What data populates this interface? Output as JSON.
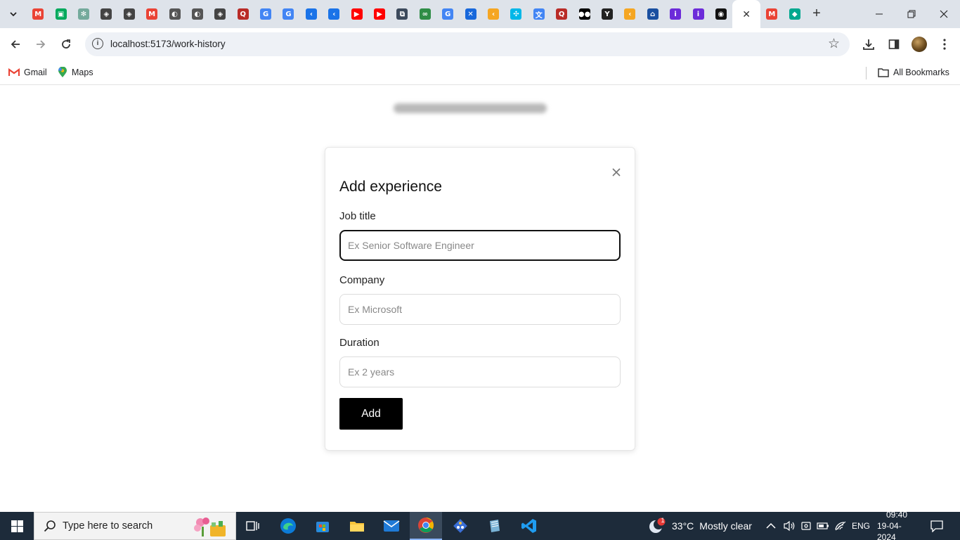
{
  "browser": {
    "tabs": [
      {
        "icon": "gmail-icon",
        "color": "#ea4335",
        "glyph": "M"
      },
      {
        "icon": "google-meet-icon",
        "color": "#00a95c",
        "glyph": "▣"
      },
      {
        "icon": "chatgpt-icon",
        "color": "#74aa9c",
        "glyph": "✻"
      },
      {
        "icon": "shield-icon",
        "color": "#444444",
        "glyph": "◈"
      },
      {
        "icon": "shield-icon",
        "color": "#444444",
        "glyph": "◈"
      },
      {
        "icon": "gmail-icon",
        "color": "#ea4335",
        "glyph": "M"
      },
      {
        "icon": "globe-icon",
        "color": "#555555",
        "glyph": "◐"
      },
      {
        "icon": "globe-icon",
        "color": "#555555",
        "glyph": "◐"
      },
      {
        "icon": "shield-icon",
        "color": "#444444",
        "glyph": "◈"
      },
      {
        "icon": "quora-icon",
        "color": "#b92b27",
        "glyph": "Q"
      },
      {
        "icon": "google-icon",
        "color": "#4285f4",
        "glyph": "G"
      },
      {
        "icon": "google-icon",
        "color": "#4285f4",
        "glyph": "G"
      },
      {
        "icon": "blue-circle-icon",
        "color": "#1a73e8",
        "glyph": "‹"
      },
      {
        "icon": "blue-circle-icon",
        "color": "#1a73e8",
        "glyph": "‹"
      },
      {
        "icon": "youtube-icon",
        "color": "#ff0000",
        "glyph": "▶"
      },
      {
        "icon": "youtube-icon",
        "color": "#ff0000",
        "glyph": "▶"
      },
      {
        "icon": "puzzle-icon",
        "color": "#3c4a5c",
        "glyph": "⧉"
      },
      {
        "icon": "geeksforgeeks-icon",
        "color": "#2f8d46",
        "glyph": "∞"
      },
      {
        "icon": "google-icon",
        "color": "#4285f4",
        "glyph": "G"
      },
      {
        "icon": "confluence-icon",
        "color": "#1868db",
        "glyph": "✕"
      },
      {
        "icon": "code-icon",
        "color": "#f5a623",
        "glyph": "‹"
      },
      {
        "icon": "puzzle-icon",
        "color": "#00b7e8",
        "glyph": "✣"
      },
      {
        "icon": "translate-icon",
        "color": "#4285f4",
        "glyph": "文"
      },
      {
        "icon": "quora-icon",
        "color": "#b92b27",
        "glyph": "Q"
      },
      {
        "icon": "medium-icon",
        "color": "#000000",
        "glyph": "●●"
      },
      {
        "icon": "typeform-icon",
        "color": "#222222",
        "glyph": "Y"
      },
      {
        "icon": "code-icon",
        "color": "#f5a623",
        "glyph": "‹"
      },
      {
        "icon": "bank-icon",
        "color": "#1a4fa0",
        "glyph": "⌂"
      },
      {
        "icon": "purple-badge-icon",
        "color": "#6c2bd9",
        "glyph": "i"
      },
      {
        "icon": "purple-badge-icon",
        "color": "#6c2bd9",
        "glyph": "i"
      },
      {
        "icon": "github-icon",
        "color": "#111111",
        "glyph": "◉"
      }
    ],
    "tabs_after": [
      {
        "icon": "gmail-icon",
        "color": "#ea4335",
        "glyph": "M"
      },
      {
        "icon": "diamond-icon",
        "color": "#00a88f",
        "glyph": "◆"
      }
    ],
    "url": "localhost:5173/work-history",
    "bookmarks": {
      "gmail": "Gmail",
      "maps": "Maps",
      "all": "All Bookmarks"
    }
  },
  "modal": {
    "title": "Add experience",
    "job_title": {
      "label": "Job title",
      "placeholder": "Ex Senior Software Engineer"
    },
    "company": {
      "label": "Company",
      "placeholder": "Ex Microsoft"
    },
    "duration": {
      "label": "Duration",
      "placeholder": "Ex 2 years"
    },
    "submit_label": "Add"
  },
  "taskbar": {
    "search_placeholder": "Type here to search",
    "weather": {
      "temp": "33°C",
      "condition": "Mostly clear",
      "alert_count": "1"
    },
    "language": "ENG",
    "time": "09:40",
    "date": "19-04-2024"
  },
  "colors": {
    "tabstrip_bg": "#dee3ea",
    "taskbar_bg": "#1d2b3a",
    "button_bg": "#000000"
  }
}
